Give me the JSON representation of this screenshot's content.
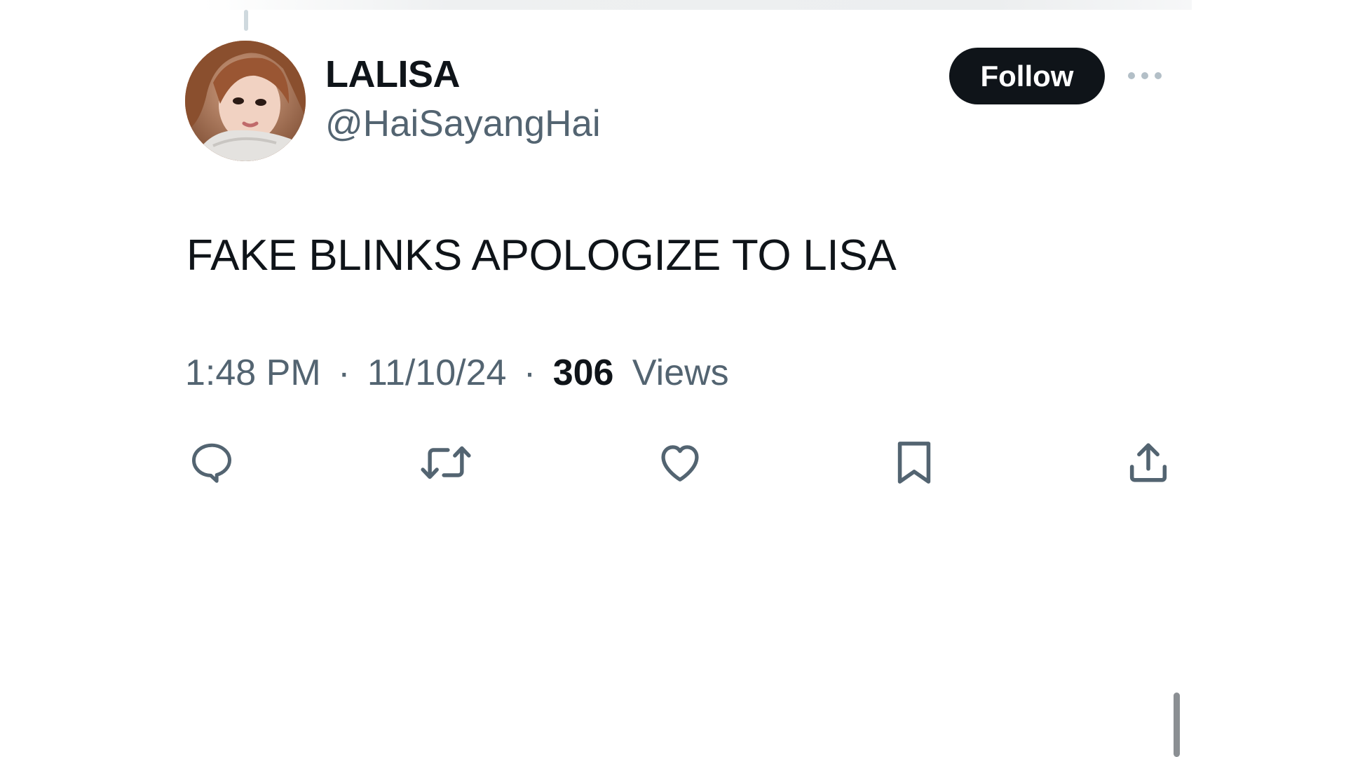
{
  "tweet": {
    "author": {
      "display_name": "LALISA",
      "handle": "@HaiSayangHai"
    },
    "follow_label": "Follow",
    "text": "FAKE BLINKS APOLOGIZE TO LISA",
    "time": "1:48 PM",
    "date": "11/10/24",
    "separator": "·",
    "views_count": "306",
    "views_label": "Views"
  },
  "actions": [
    {
      "icon": "reply-icon"
    },
    {
      "icon": "retweet-icon"
    },
    {
      "icon": "like-icon"
    },
    {
      "icon": "bookmark-icon"
    },
    {
      "icon": "share-icon"
    }
  ],
  "colors": {
    "text_primary": "#0f1419",
    "text_secondary": "#536471",
    "follow_bg": "#0f1419",
    "follow_fg": "#ffffff"
  }
}
